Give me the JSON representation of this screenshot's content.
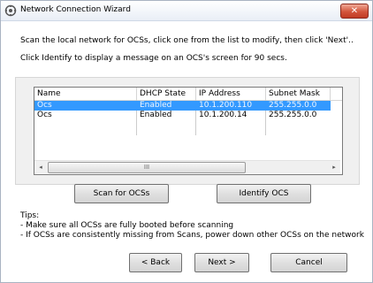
{
  "window": {
    "title": "Network Connection Wizard",
    "close_glyph": "✕",
    "icon": "network-wizard-icon"
  },
  "instructions": {
    "line1": "Scan the local network for OCSs, click one from the list to modify, then click 'Next'..",
    "line2": "Click Identify to display a message on an OCS's screen for 90 secs."
  },
  "table": {
    "columns": [
      "Name",
      "DHCP State",
      "IP Address",
      "Subnet Mask"
    ],
    "rows": [
      {
        "name": "Ocs",
        "dhcp": "Enabled",
        "ip": "10.1.200.110",
        "mask": "255.255.0.0",
        "selected": true
      },
      {
        "name": "Ocs",
        "dhcp": "Enabled",
        "ip": "10.1.200.14",
        "mask": "255.255.0.0",
        "selected": false
      }
    ],
    "scroll_left_glyph": "◂",
    "scroll_right_glyph": "▸",
    "thumb_grip": "III"
  },
  "buttons": {
    "scan": "Scan for OCSs",
    "identify": "Identify OCS",
    "back": "< Back",
    "next": "Next >",
    "cancel": "Cancel"
  },
  "tips": {
    "heading": "Tips:",
    "items": [
      "- Make sure all OCSs are fully booted before scanning",
      "- If OCSs are consistently missing from Scans, power down other OCSs on the network"
    ]
  },
  "colors": {
    "selection": "#3399ff",
    "close_button": "#c8452c"
  }
}
